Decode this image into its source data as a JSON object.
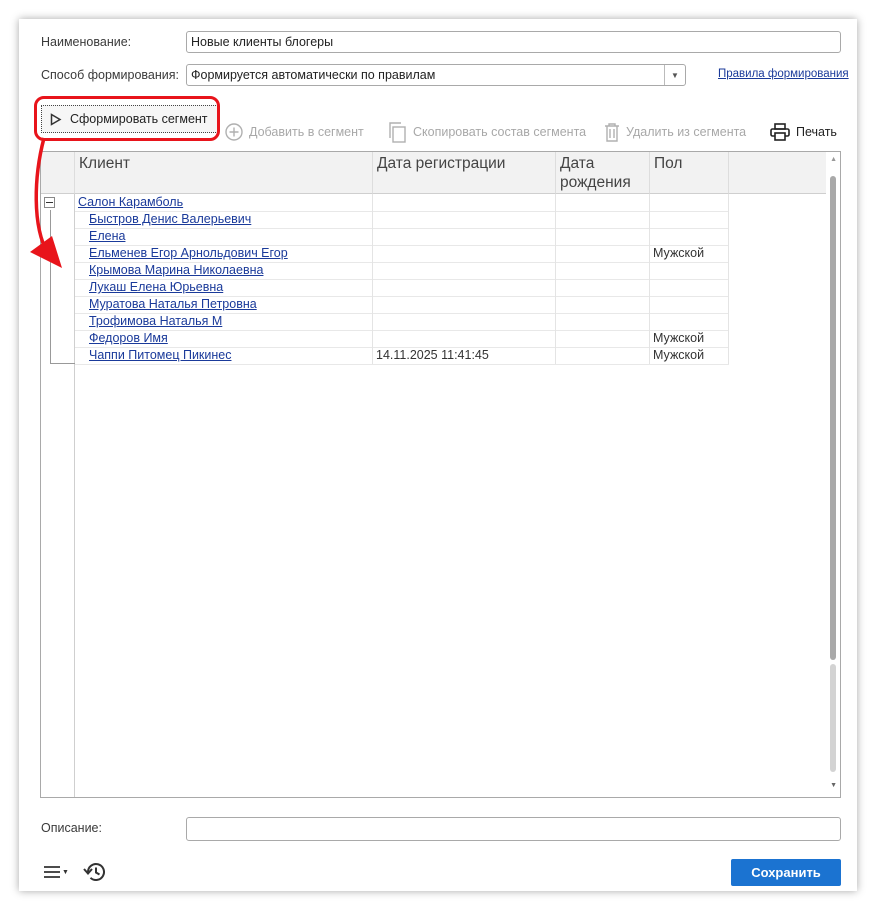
{
  "form": {
    "name_label": "Наименование:",
    "name_value": "Новые клиенты блогеры",
    "method_label": "Способ формирования:",
    "method_value": "Формируется автоматически по правилам",
    "rules_link": "Правила формирования",
    "description_label": "Описание:",
    "description_value": ""
  },
  "toolbar": {
    "form_segment": "Сформировать сегмент",
    "add_to_segment": "Добавить в сегмент",
    "copy_segment": "Скопировать состав сегмента",
    "delete_from_segment": "Удалить из сегмента",
    "print": "Печать"
  },
  "table": {
    "headers": {
      "client": "Клиент",
      "reg_date": "Дата регистрации",
      "birth_date": "Дата рождения",
      "gender": "Пол"
    },
    "group": "Салон Карамболь",
    "rows": [
      {
        "client": "Быстров Денис Валерьевич",
        "reg_date": "",
        "birth_date": "",
        "gender": ""
      },
      {
        "client": "Елена",
        "reg_date": "",
        "birth_date": "",
        "gender": ""
      },
      {
        "client": "Ельменев Егор Арнольдович Егор",
        "reg_date": "",
        "birth_date": "",
        "gender": "Мужской"
      },
      {
        "client": "Крымова Марина Николаевна",
        "reg_date": "",
        "birth_date": "",
        "gender": ""
      },
      {
        "client": "Лукаш Елена Юрьевна",
        "reg_date": "",
        "birth_date": "",
        "gender": ""
      },
      {
        "client": "Муратова Наталья Петровна",
        "reg_date": "",
        "birth_date": "",
        "gender": ""
      },
      {
        "client": "Трофимова Наталья М",
        "reg_date": "",
        "birth_date": "",
        "gender": ""
      },
      {
        "client": "Федоров Имя",
        "reg_date": "",
        "birth_date": "",
        "gender": "Мужской"
      },
      {
        "client": "Чаппи Питомец Пикинес",
        "reg_date": "14.11.2025 11:41:45",
        "birth_date": "",
        "gender": "Мужской"
      }
    ]
  },
  "footer": {
    "save": "Сохранить"
  },
  "colors": {
    "accent": "#1b73d1",
    "link": "#1a3a9a",
    "annotation": "#e8141b"
  }
}
